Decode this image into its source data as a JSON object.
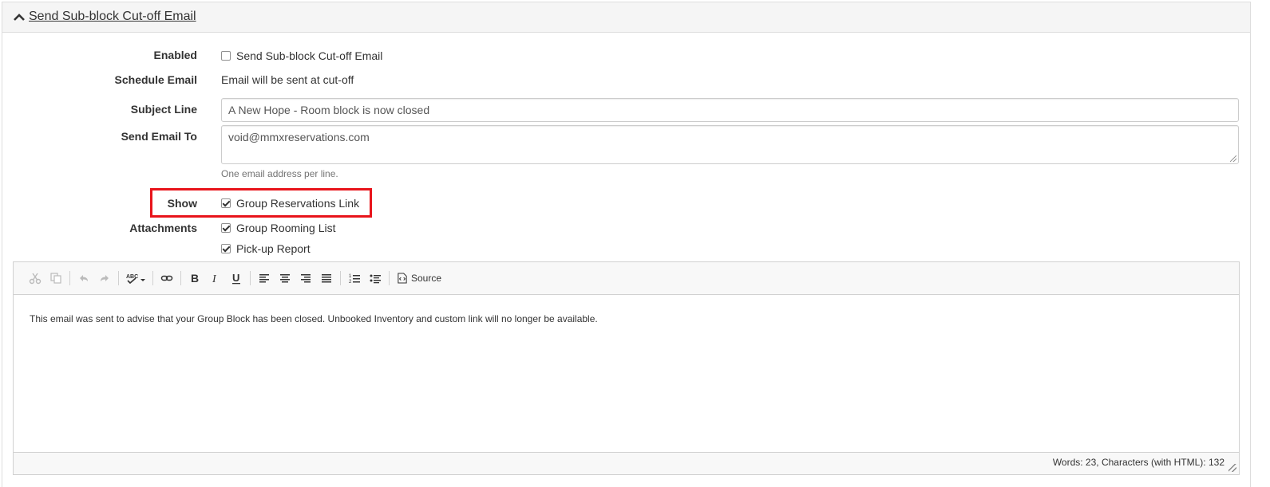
{
  "panel": {
    "title": "Send Sub-block Cut-off Email",
    "icon": "chevron-up-icon"
  },
  "form": {
    "enabled": {
      "label": "Enabled",
      "checkbox_label": "Send Sub-block Cut-off Email",
      "checked": false
    },
    "schedule": {
      "label": "Schedule Email",
      "value": "Email will be sent at cut-off"
    },
    "subject": {
      "label": "Subject Line",
      "value": "A New Hope - Room block is now closed"
    },
    "send_to": {
      "label": "Send Email To",
      "value": "void@mmxreservations.com",
      "help": "One email address per line."
    },
    "show": {
      "label": "Show",
      "checkbox_label": "Group Reservations Link",
      "checked": true
    },
    "attachments": {
      "label": "Attachments",
      "items": [
        {
          "label": "Group Rooming List",
          "checked": true
        },
        {
          "label": "Pick-up Report",
          "checked": true
        }
      ]
    }
  },
  "editor": {
    "toolbar": {
      "buttons": [
        {
          "name": "cut-icon",
          "glyph": "✂",
          "enabled": false
        },
        {
          "name": "copy-icon",
          "glyph": "⎘",
          "enabled": false
        },
        {
          "name": "undo-icon",
          "glyph": "↶",
          "enabled": false
        },
        {
          "name": "redo-icon",
          "glyph": "↷",
          "enabled": false
        },
        {
          "name": "spellcheck-icon",
          "glyph": "ABC",
          "enabled": true
        },
        {
          "name": "link-icon",
          "glyph": "🔗",
          "enabled": true
        },
        {
          "name": "bold-icon",
          "glyph": "B",
          "enabled": true
        },
        {
          "name": "italic-icon",
          "glyph": "I",
          "enabled": true
        },
        {
          "name": "underline-icon",
          "glyph": "U",
          "enabled": true
        },
        {
          "name": "align-left-icon",
          "glyph": "≡",
          "enabled": true
        },
        {
          "name": "align-center-icon",
          "glyph": "≡",
          "enabled": true
        },
        {
          "name": "align-right-icon",
          "glyph": "≡",
          "enabled": true
        },
        {
          "name": "align-justify-icon",
          "glyph": "≡",
          "enabled": true
        },
        {
          "name": "numbered-list-icon",
          "glyph": "1≡",
          "enabled": true
        },
        {
          "name": "bullet-list-icon",
          "glyph": "•≡",
          "enabled": true
        }
      ],
      "source_label": "Source"
    },
    "content": "This email was sent to advise that your Group Block has been closed. Unbooked Inventory and custom link will no longer be available.",
    "status": "Words: 23, Characters (with HTML): 132"
  },
  "colors": {
    "highlight_border": "#e8141b",
    "panel_heading_bg": "#f5f5f5"
  }
}
